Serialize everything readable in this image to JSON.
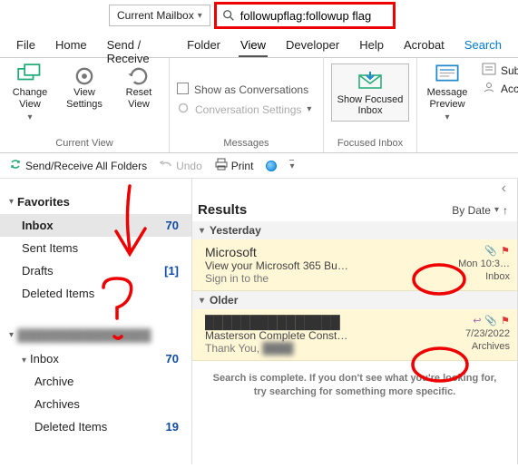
{
  "search": {
    "mailbox": "Current Mailbox",
    "query": "followupflag:followup flag"
  },
  "menu": {
    "file": "File",
    "home": "Home",
    "sendrecv": "Send / Receive",
    "folder": "Folder",
    "view": "View",
    "developer": "Developer",
    "help": "Help",
    "acrobat": "Acrobat",
    "search": "Search"
  },
  "ribbon": {
    "g1": {
      "changeView": "Change View",
      "viewSettings": "View Settings",
      "resetView": "Reset View",
      "label": "Current View"
    },
    "g2": {
      "showConv": "Show as Conversations",
      "convSettings": "Conversation Settings",
      "label": "Messages"
    },
    "g3": {
      "showFocused": "Show Focused Inbox",
      "label": "Focused Inbox"
    },
    "g4": {
      "msgPreview": "Message Preview"
    },
    "g5": {
      "subject": "Subject",
      "account": "Account"
    }
  },
  "quick": {
    "sendAll": "Send/Receive All Folders",
    "undo": "Undo",
    "print": "Print"
  },
  "nav": {
    "favorites": "Favorites",
    "items": [
      {
        "label": "Inbox",
        "count": "70",
        "sel": true
      },
      {
        "label": "Sent Items",
        "count": ""
      },
      {
        "label": "Drafts",
        "count": "[1]"
      },
      {
        "label": "Deleted Items",
        "count": ""
      }
    ],
    "account": "████████████████",
    "tree": [
      {
        "label": "Inbox",
        "count": "70"
      },
      {
        "label": "Archive",
        "count": ""
      },
      {
        "label": "Archives",
        "count": ""
      },
      {
        "label": "Deleted Items",
        "count": "19"
      }
    ]
  },
  "results": {
    "title": "Results",
    "sort": "By Date",
    "groups": [
      {
        "label": "Yesterday",
        "msgs": [
          {
            "sender": "Microsoft",
            "subject": "View your Microsoft 365 Bu…",
            "preview": "Sign in to the",
            "time": "Mon 10:3…",
            "folder": "Inbox",
            "att": true,
            "flag": true,
            "reply": false
          }
        ]
      },
      {
        "label": "Older",
        "msgs": [
          {
            "sender": "███████████████",
            "subject": "Masterson Complete Const…",
            "preview": "Thank You, ████",
            "time": "7/23/2022",
            "folder": "Archives",
            "att": true,
            "flag": true,
            "reply": true
          }
        ]
      }
    ],
    "complete": "Search is complete. If you don't see what you're looking for, try searching for something more specific."
  },
  "chevDown": "▾",
  "chevRight": "›",
  "chevLeft": "‹"
}
